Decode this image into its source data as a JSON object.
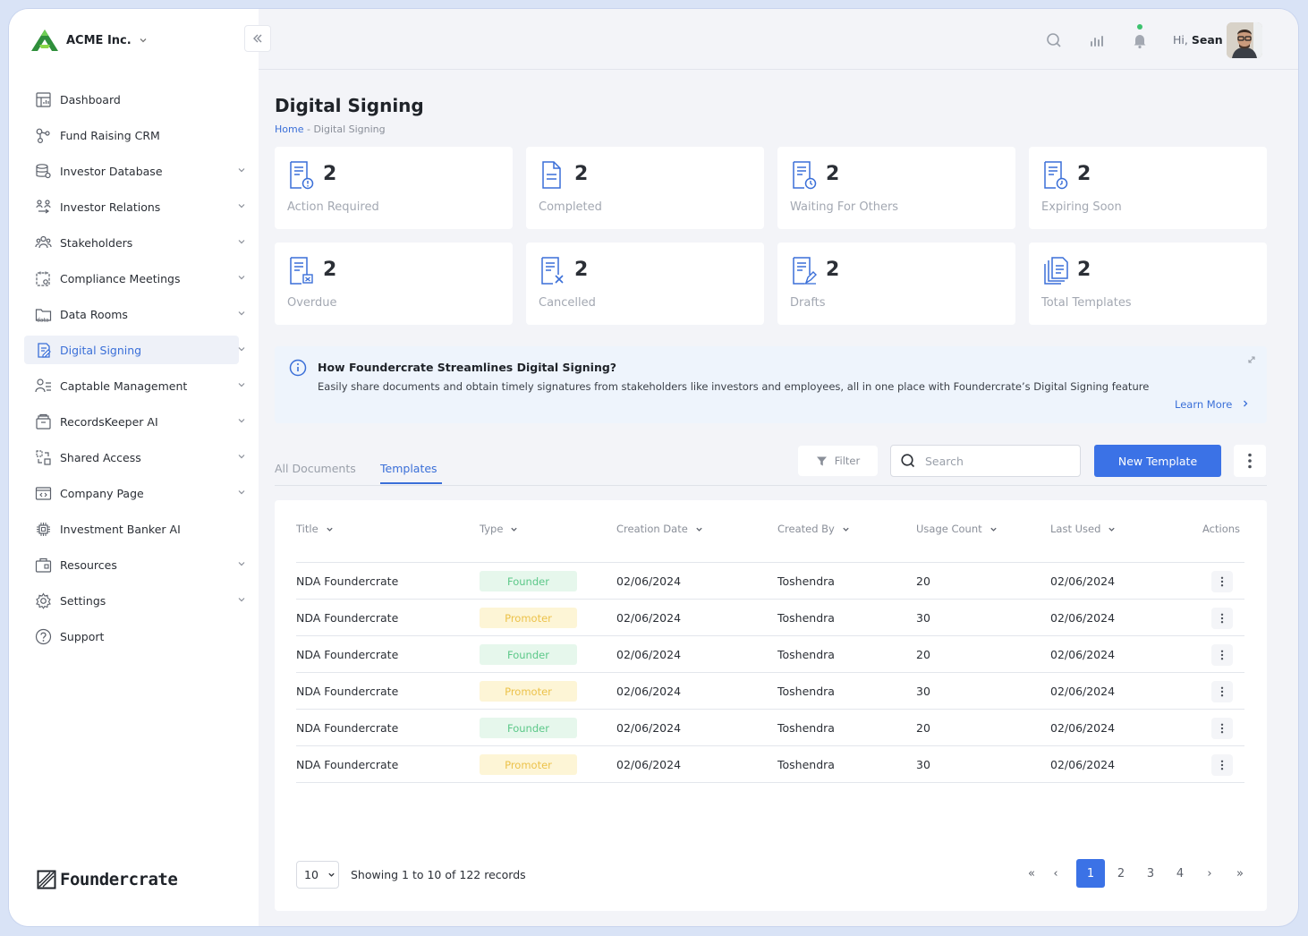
{
  "org": {
    "name": "ACME Inc."
  },
  "sidebar": {
    "items": [
      {
        "label": "Dashboard",
        "icon": "dashboard-icon",
        "chevron": false
      },
      {
        "label": "Fund Raising CRM",
        "icon": "crm-icon",
        "chevron": false
      },
      {
        "label": "Investor Database",
        "icon": "database-icon",
        "chevron": true
      },
      {
        "label": "Investor Relations",
        "icon": "relations-icon",
        "chevron": true
      },
      {
        "label": "Stakeholders",
        "icon": "stakeholders-icon",
        "chevron": true
      },
      {
        "label": "Compliance Meetings",
        "icon": "compliance-icon",
        "chevron": true
      },
      {
        "label": "Data Rooms",
        "icon": "data-folder-icon",
        "chevron": true
      },
      {
        "label": "Digital Signing",
        "icon": "signing-icon",
        "chevron": true,
        "active": true
      },
      {
        "label": "Captable Management",
        "icon": "captable-icon",
        "chevron": true
      },
      {
        "label": "RecordsKeeper AI",
        "icon": "records-icon",
        "chevron": true
      },
      {
        "label": "Shared Access",
        "icon": "share-icon",
        "chevron": true
      },
      {
        "label": "Company Page",
        "icon": "company-icon",
        "chevron": true
      },
      {
        "label": "Investment Banker AI",
        "icon": "chip-icon",
        "chevron": false
      },
      {
        "label": "Resources",
        "icon": "resources-icon",
        "chevron": true
      },
      {
        "label": "Settings",
        "icon": "gear-icon",
        "chevron": true
      },
      {
        "label": "Support",
        "icon": "help-icon",
        "chevron": false
      }
    ],
    "brand": "Foundercrate"
  },
  "header": {
    "greeting": "Hi,",
    "user": "Sean"
  },
  "page": {
    "title": "Digital Signing",
    "breadcrumb_home": "Home",
    "breadcrumb_sep": " - ",
    "breadcrumb_current": "Digital Signing"
  },
  "stats": [
    {
      "value": "2",
      "label": "Action Required"
    },
    {
      "value": "2",
      "label": "Completed"
    },
    {
      "value": "2",
      "label": "Waiting For Others"
    },
    {
      "value": "2",
      "label": "Expiring Soon"
    },
    {
      "value": "2",
      "label": "Overdue"
    },
    {
      "value": "2",
      "label": "Cancelled"
    },
    {
      "value": "2",
      "label": "Drafts"
    },
    {
      "value": "2",
      "label": "Total Templates"
    }
  ],
  "info": {
    "title": "How Foundercrate Streamlines Digital Signing?",
    "description": "Easily share documents and obtain timely signatures from stakeholders like investors and employees, all in one place with Foundercrate’s Digital Signing feature",
    "link": "Learn More"
  },
  "tabs": {
    "all": "All Documents",
    "templates": "Templates"
  },
  "toolbar": {
    "filter": "Filter",
    "search_placeholder": "Search",
    "new_template": "New Template"
  },
  "table": {
    "columns": [
      "Title",
      "Type",
      "Creation Date",
      "Created By",
      "Usage Count",
      "Last Used",
      "Actions"
    ],
    "rows": [
      {
        "title": "NDA Foundercrate",
        "type": "Founder",
        "created": "02/06/2024",
        "by": "Toshendra",
        "usage": "20",
        "last": "02/06/2024"
      },
      {
        "title": "NDA Foundercrate",
        "type": "Promoter",
        "created": "02/06/2024",
        "by": "Toshendra",
        "usage": "30",
        "last": "02/06/2024"
      },
      {
        "title": "NDA Foundercrate",
        "type": "Founder",
        "created": "02/06/2024",
        "by": "Toshendra",
        "usage": "20",
        "last": "02/06/2024"
      },
      {
        "title": "NDA Foundercrate",
        "type": "Promoter",
        "created": "02/06/2024",
        "by": "Toshendra",
        "usage": "30",
        "last": "02/06/2024"
      },
      {
        "title": "NDA Foundercrate",
        "type": "Founder",
        "created": "02/06/2024",
        "by": "Toshendra",
        "usage": "20",
        "last": "02/06/2024"
      },
      {
        "title": "NDA Foundercrate",
        "type": "Promoter",
        "created": "02/06/2024",
        "by": "Toshendra",
        "usage": "30",
        "last": "02/06/2024"
      }
    ]
  },
  "pagination": {
    "page_size": "10",
    "info": "Showing 1 to 10 of 122 records",
    "first": "«",
    "prev": "‹",
    "next": "›",
    "last": "»",
    "pages": [
      "1",
      "2",
      "3",
      "4"
    ],
    "current": "1"
  },
  "colors": {
    "accent": "#3b72e6",
    "founder": "#5cc889",
    "promoter": "#ecc24b",
    "online": "#3cc26e"
  }
}
